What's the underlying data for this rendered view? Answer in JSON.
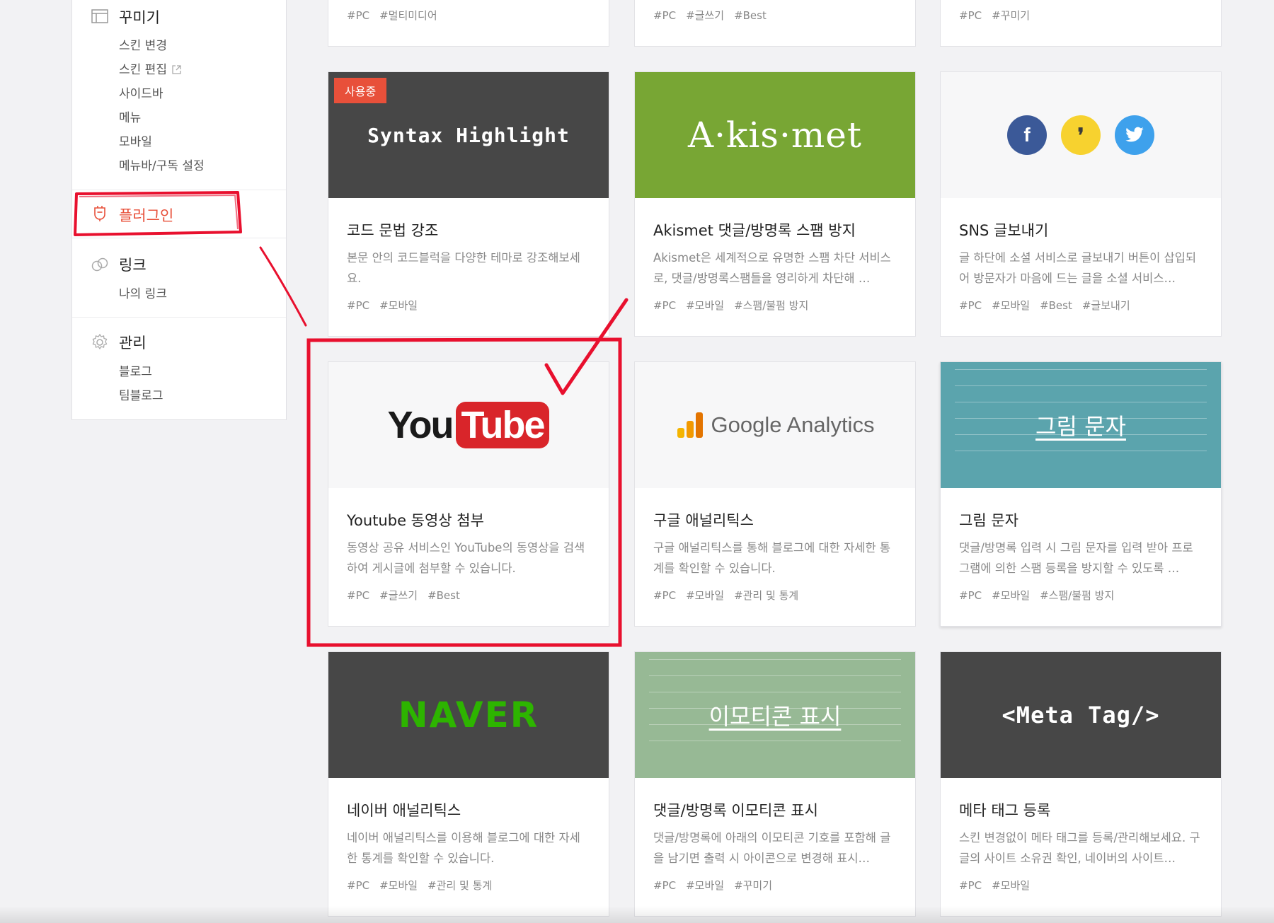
{
  "sidebar": {
    "decorate": {
      "heading": "꾸미기",
      "items": [
        "스킨 변경",
        "스킨 편집",
        "사이드바",
        "메뉴",
        "모바일",
        "메뉴바/구독 설정"
      ]
    },
    "plugin": {
      "label": "플러그인"
    },
    "link": {
      "heading": "링크",
      "items": [
        "나의 링크"
      ]
    },
    "manage": {
      "heading": "관리",
      "items": [
        "블로그",
        "팀블로그"
      ]
    }
  },
  "top_row": [
    {
      "tags": [
        "#PC",
        "#멀티미디어"
      ]
    },
    {
      "tags": [
        "#PC",
        "#글쓰기",
        "#Best"
      ]
    },
    {
      "tags": [
        "#PC",
        "#꾸미기"
      ]
    }
  ],
  "cards": [
    {
      "badge": "사용중",
      "thumb_text": "Syntax Highlight",
      "title": "코드 문법 강조",
      "desc": "본문 안의 코드블럭을 다양한 테마로 강조해보세요.",
      "tags": [
        "#PC",
        "#모바일"
      ]
    },
    {
      "thumb_text": "A·kis·met",
      "title": "Akismet 댓글/방명록 스팸 방지",
      "desc": "Akismet은 세계적으로 유명한 스팸 차단 서비스로, 댓글/방명록스팸들을 영리하게 차단해 …",
      "tags": [
        "#PC",
        "#모바일",
        "#스팸/불펌 방지"
      ]
    },
    {
      "icons": [
        "f",
        "❜",
        "🐦"
      ],
      "title": "SNS 글보내기",
      "desc": "글 하단에 소셜 서비스로 글보내기 버튼이 삽입되어 방문자가 마음에 드는 글을 소셜 서비스…",
      "tags": [
        "#PC",
        "#모바일",
        "#Best",
        "#글보내기"
      ]
    },
    {
      "thumb_text_you": "You",
      "thumb_text_tube": "Tube",
      "title": "Youtube 동영상 첨부",
      "desc": "동영상 공유 서비스인 YouTube의 동영상을 검색하여 게시글에 첨부할 수 있습니다.",
      "tags": [
        "#PC",
        "#글쓰기",
        "#Best"
      ]
    },
    {
      "thumb_text": "Google Analytics",
      "title": "구글 애널리틱스",
      "desc": "구글 애널리틱스를 통해 블로그에 대한 자세한 통계를 확인할 수 있습니다.",
      "tags": [
        "#PC",
        "#모바일",
        "#관리 및 통계"
      ]
    },
    {
      "thumb_text": "그림 문자",
      "title": "그림 문자",
      "desc": "댓글/방명록 입력 시 그림 문자를 입력 받아 프로그램에 의한 스팸 등록을 방지할 수 있도록 …",
      "tags": [
        "#PC",
        "#모바일",
        "#스팸/불펌 방지"
      ]
    },
    {
      "thumb_text": "NAVER",
      "title": "네이버 애널리틱스",
      "desc": "네이버 애널리틱스를 이용해 블로그에 대한 자세한 통계를 확인할 수 있습니다.",
      "tags": [
        "#PC",
        "#모바일",
        "#관리 및 통계"
      ]
    },
    {
      "thumb_text": "이모티콘 표시",
      "title": "댓글/방명록 이모티콘 표시",
      "desc": "댓글/방명록에 아래의 이모티콘 기호를 포함해 글을 남기면 출력 시 아이콘으로 변경해 표시…",
      "tags": [
        "#PC",
        "#모바일",
        "#꾸미기"
      ]
    },
    {
      "thumb_text": "<Meta Tag/>",
      "title": "메타 태그 등록",
      "desc": "스킨 변경없이 메타 태그를 등록/관리해보세요. 구글의 사이트 소유권 확인, 네이버의 사이트…",
      "tags": [
        "#PC",
        "#모바일"
      ]
    }
  ],
  "colors": {
    "accent": "#e8503a",
    "annotation_red": "#e8102e",
    "naver_green": "#2db400",
    "akismet_green": "#78a634",
    "youtube_red": "#d9252a"
  }
}
